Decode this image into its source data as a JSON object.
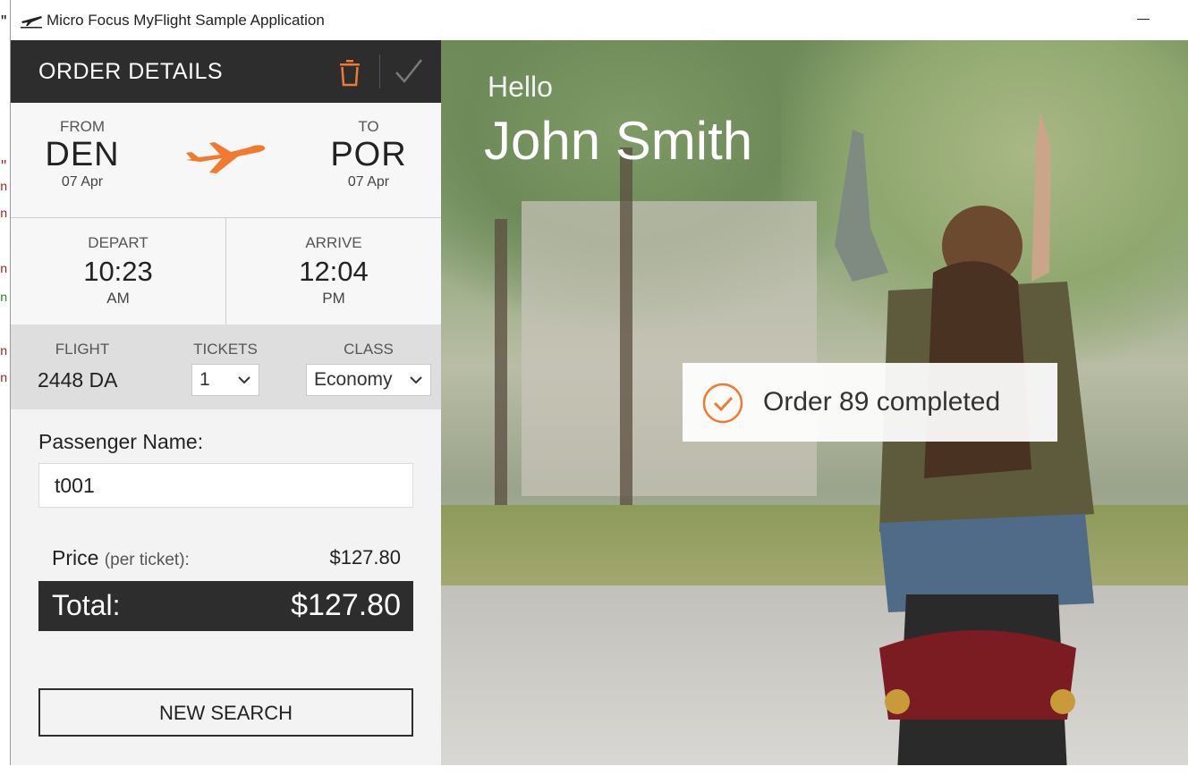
{
  "window": {
    "title": "Micro Focus MyFlight Sample Application"
  },
  "order": {
    "header_title": "ORDER DETAILS",
    "from_label": "FROM",
    "from_city": "DEN",
    "from_date": "07 Apr",
    "to_label": "TO",
    "to_city": "POR",
    "to_date": "07 Apr",
    "depart_label": "DEPART",
    "depart_time": "10:23",
    "depart_ampm": "AM",
    "arrive_label": "ARRIVE",
    "arrive_time": "12:04",
    "arrive_ampm": "PM",
    "flight_label": "FLIGHT",
    "flight_number": "2448 DA",
    "tickets_label": "TICKETS",
    "tickets_value": "1",
    "class_label": "CLASS",
    "class_value": "Economy",
    "passenger_label": "Passenger Name:",
    "passenger_value": "t001",
    "price_label": "Price",
    "price_sub": "(per ticket):",
    "price_value": "$127.80",
    "total_label": "Total:",
    "total_value": "$127.80",
    "new_search_label": "NEW SEARCH"
  },
  "greeting": {
    "hello": "Hello",
    "name": "John Smith"
  },
  "toast": {
    "message": "Order 89 completed"
  },
  "colors": {
    "accent": "#f07a30",
    "header_bg": "#2d2d2d",
    "panel_bg": "#f3f3f3"
  }
}
